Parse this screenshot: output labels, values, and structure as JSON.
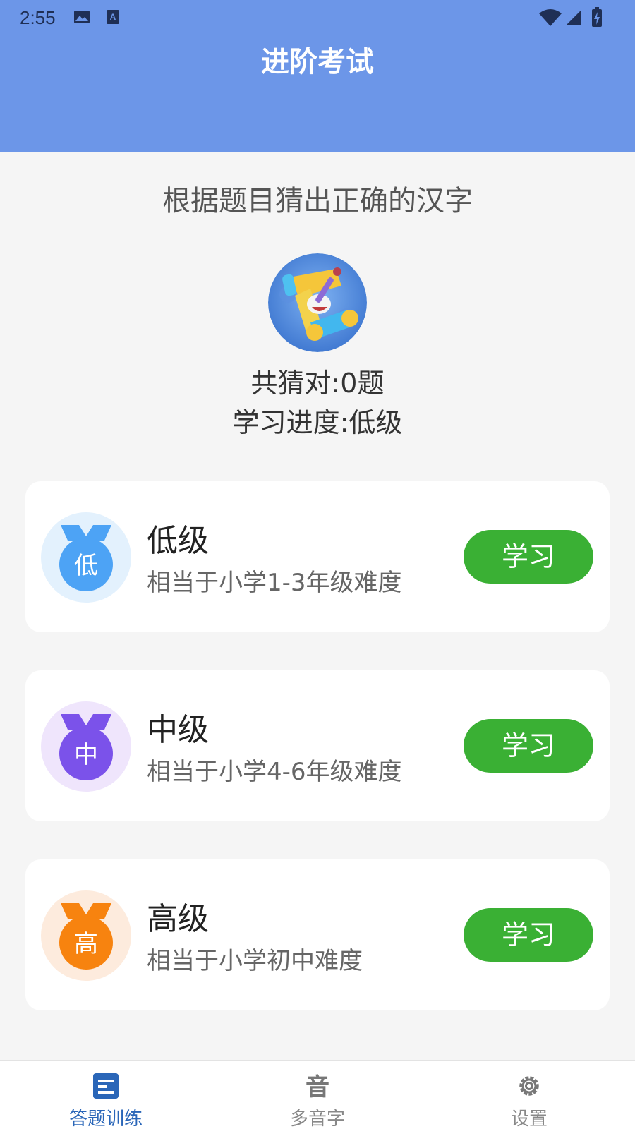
{
  "status_bar": {
    "time": "2:55"
  },
  "header": {
    "title": "进阶考试"
  },
  "subtitle": "根据题目猜出正确的汉字",
  "stats": {
    "guessed_label": "共猜对:0题",
    "progress_label": "学习进度:低级"
  },
  "levels": [
    {
      "badge_char": "低",
      "title": "低级",
      "desc": "相当于小学1-3年级难度",
      "button": "学习",
      "color": "#4da3f5",
      "bg": "#e3f1fd"
    },
    {
      "badge_char": "中",
      "title": "中级",
      "desc": "相当于小学4-6年级难度",
      "button": "学习",
      "color": "#7b52ea",
      "bg": "#efe5fc"
    },
    {
      "badge_char": "高",
      "title": "高级",
      "desc": "相当于小学初中难度",
      "button": "学习",
      "color": "#f7830f",
      "bg": "#fdebdd"
    }
  ],
  "tabbar": {
    "tabs": [
      {
        "label": "答题训练",
        "icon": "quiz-icon",
        "active": true
      },
      {
        "label": "多音字",
        "icon": "polyphone-icon",
        "active": false
      },
      {
        "label": "设置",
        "icon": "gear-icon",
        "active": false
      }
    ]
  },
  "colors": {
    "header": "#6c96e8",
    "button": "#3ab034",
    "tab_active": "#2a66b8"
  }
}
